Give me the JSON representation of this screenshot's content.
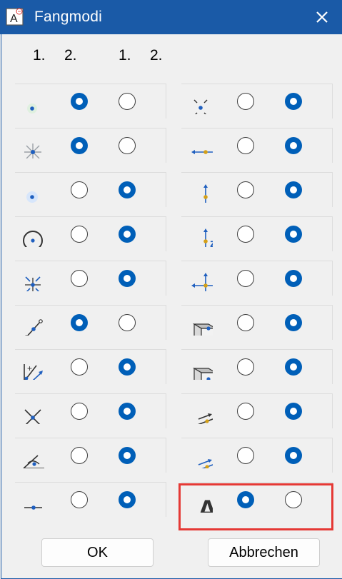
{
  "window": {
    "title": "Fangmodi",
    "icon_letter": "A",
    "close_glyph": "✕"
  },
  "column_headers": {
    "left": [
      "1.",
      "2."
    ],
    "right": [
      "1.",
      "2."
    ]
  },
  "left_rows": [
    {
      "icon": "point-icon",
      "selected": 1
    },
    {
      "icon": "center-icon",
      "selected": 1
    },
    {
      "icon": "midpoint-icon",
      "selected": 2
    },
    {
      "icon": "circle-center-icon",
      "selected": 2
    },
    {
      "icon": "nearest-point-icon",
      "selected": 2
    },
    {
      "icon": "line-endpoint-icon",
      "selected": 1
    },
    {
      "icon": "perpendicular-icon",
      "selected": 2
    },
    {
      "icon": "intersection-icon",
      "selected": 2
    },
    {
      "icon": "angle-icon",
      "selected": 2
    },
    {
      "icon": "line-point-icon",
      "selected": 2
    }
  ],
  "right_rows": [
    {
      "icon": "intersection-snap-icon",
      "selected": 2
    },
    {
      "icon": "horizontal-icon",
      "selected": 2
    },
    {
      "icon": "vertical-icon",
      "selected": 2
    },
    {
      "icon": "z-axis-icon",
      "selected": 2
    },
    {
      "icon": "cross-snap-icon",
      "selected": 2
    },
    {
      "icon": "cube-corner-icon",
      "selected": 2
    },
    {
      "icon": "cube-face-icon",
      "selected": 2
    },
    {
      "icon": "parallel-icon",
      "selected": 2
    },
    {
      "icon": "tangent-icon",
      "selected": 2
    },
    {
      "icon": "text-snap-icon",
      "icon_text": "A",
      "selected": 1
    }
  ],
  "buttons": {
    "ok": "OK",
    "cancel": "Abbrechen"
  },
  "colors": {
    "title_bar": "#1a5aa7",
    "radio_selected": "#005fb8",
    "highlight": "#e53935",
    "icon_blue": "#1f5fbf",
    "icon_gold": "#d4a017"
  }
}
